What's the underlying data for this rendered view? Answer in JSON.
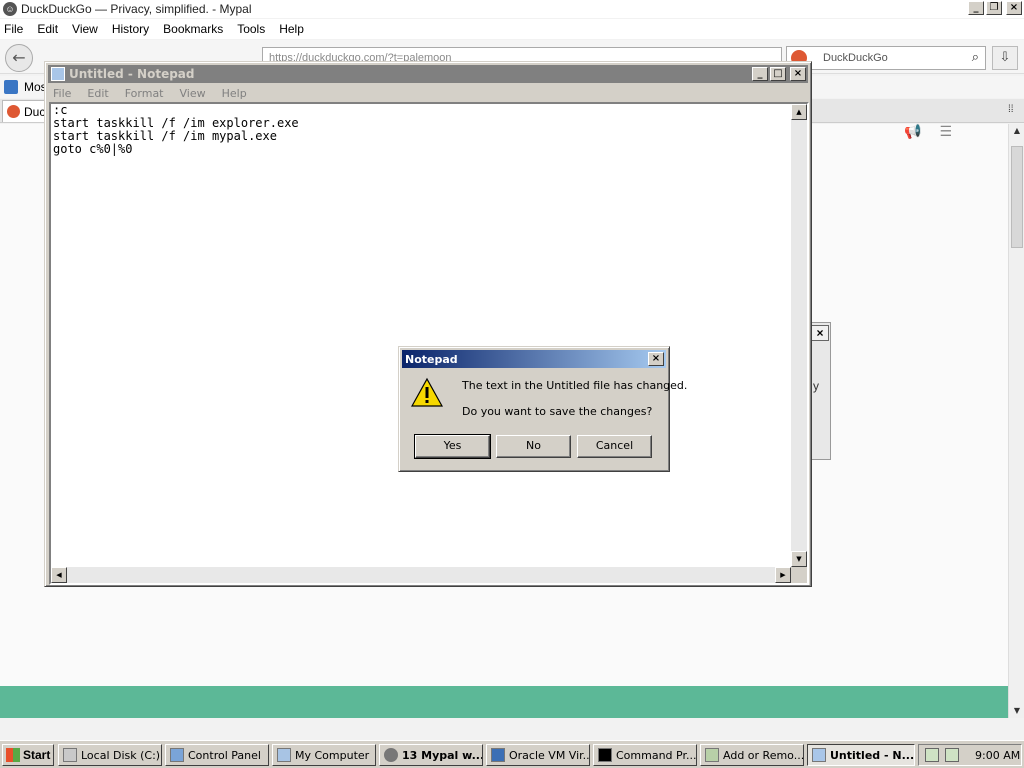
{
  "browser": {
    "title": "DuckDuckGo — Privacy, simplified. - Mypal",
    "menu": [
      "File",
      "Edit",
      "View",
      "History",
      "Bookmarks",
      "Tools",
      "Help"
    ],
    "url_fragment": "https://duckduckgo.com/?t=palemoon",
    "search_placeholder": "DuckDuckGo",
    "bookmark_label": "Mos",
    "tab_label": "Duck"
  },
  "side_panel": {
    "close": "×",
    "fragment": "y"
  },
  "notepad": {
    "title": "Untitled - Notepad",
    "menu": [
      "File",
      "Edit",
      "Format",
      "View",
      "Help"
    ],
    "text": ":c\nstart taskkill /f /im explorer.exe\nstart taskkill /f /im mypal.exe\ngoto c%0|%0"
  },
  "dialog": {
    "title": "Notepad",
    "message1": "The text in the Untitled file has changed.",
    "message2": "Do you want to save the changes?",
    "yes": "Yes",
    "no": "No",
    "cancel": "Cancel"
  },
  "taskbar": {
    "start": "Start",
    "tasks": [
      "Local Disk (C:)",
      "Control Panel",
      "My Computer",
      "13 Mypal w...",
      "Oracle VM Vir...",
      "Command Pr...",
      "Add or Remo...",
      "Untitled - N..."
    ],
    "clock": "9:00 AM"
  },
  "colors": {
    "accent_green": "#5cb897",
    "title_blue": "#0a246a",
    "ddg_orange": "#de5833"
  },
  "icons": [
    "mypal-icon",
    "back-icon",
    "reload-icon",
    "home-icon",
    "search-icon",
    "download-icon",
    "warning-icon",
    "windows-logo-icon"
  ]
}
